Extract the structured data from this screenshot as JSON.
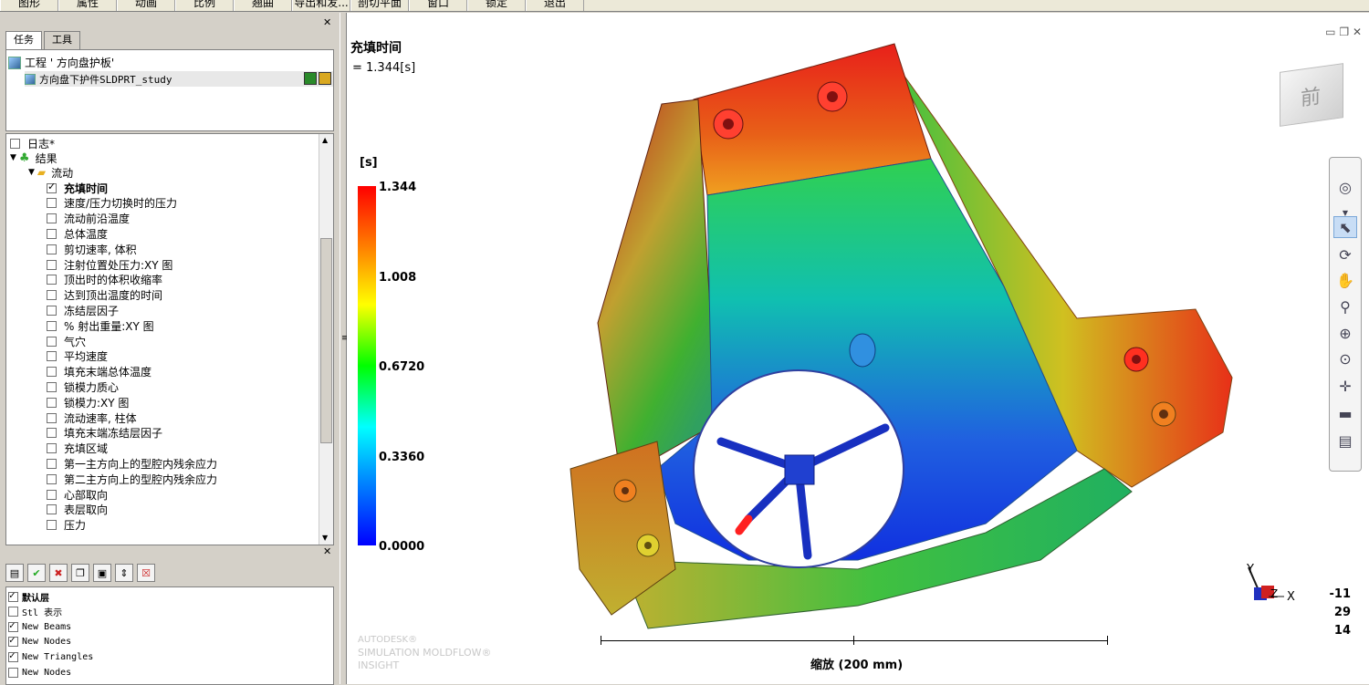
{
  "menubar": {
    "items": [
      "图形",
      "属性",
      "动画",
      "比例",
      "翘曲",
      "导出和发...",
      "剖切平面",
      "窗口",
      "锁定",
      "退出"
    ]
  },
  "left_panel": {
    "tabs": [
      "任务",
      "工具"
    ],
    "project": {
      "name": "工程 ' 方向盘护板'",
      "study": "方向盘下护件SLDPRT_study"
    },
    "tree": {
      "log": "日志*",
      "results": "结果",
      "flow": "流动",
      "items": [
        {
          "label": "充填时间",
          "checked": true
        },
        {
          "label": "速度/压力切换时的压力",
          "checked": false
        },
        {
          "label": "流动前沿温度",
          "checked": false
        },
        {
          "label": "总体温度",
          "checked": false
        },
        {
          "label": "剪切速率, 体积",
          "checked": false
        },
        {
          "label": "注射位置处压力:XY 图",
          "checked": false
        },
        {
          "label": "顶出时的体积收缩率",
          "checked": false
        },
        {
          "label": "达到顶出温度的时间",
          "checked": false
        },
        {
          "label": "冻结层因子",
          "checked": false
        },
        {
          "label": "% 射出重量:XY 图",
          "checked": false
        },
        {
          "label": "气穴",
          "checked": false
        },
        {
          "label": "平均速度",
          "checked": false
        },
        {
          "label": "填充末端总体温度",
          "checked": false
        },
        {
          "label": "锁模力质心",
          "checked": false
        },
        {
          "label": "锁模力:XY 图",
          "checked": false
        },
        {
          "label": "流动速率, 柱体",
          "checked": false
        },
        {
          "label": "填充末端冻结层因子",
          "checked": false
        },
        {
          "label": "充填区域",
          "checked": false
        },
        {
          "label": "第一主方向上的型腔内残余应力",
          "checked": false
        },
        {
          "label": "第二主方向上的型腔内残余应力",
          "checked": false
        },
        {
          "label": "心部取向",
          "checked": false
        },
        {
          "label": "表层取向",
          "checked": false
        },
        {
          "label": "压力",
          "checked": false
        }
      ]
    },
    "layers": [
      {
        "label": "默认层",
        "checked": true
      },
      {
        "label": "Stl 表示",
        "checked": false
      },
      {
        "label": "New Beams",
        "checked": true
      },
      {
        "label": "New Nodes",
        "checked": true
      },
      {
        "label": "New Triangles",
        "checked": true
      },
      {
        "label": "New Nodes",
        "checked": false
      }
    ]
  },
  "viewport": {
    "result_title": "充填时间",
    "result_value": "= 1.344[s]",
    "legend": {
      "unit": "[s]",
      "labels": [
        "1.344",
        "1.008",
        "0.6720",
        "0.3360",
        "0.0000"
      ]
    },
    "scale": "缩放 (200 mm)",
    "brand": [
      "AUTODESK®",
      "SIMULATION MOLDFLOW®",
      "INSIGHT"
    ],
    "axes": {
      "y": "Y",
      "z": "Z",
      "x": "X"
    },
    "rotation": [
      "-11",
      "29",
      "14"
    ],
    "view_cube_label": "前"
  }
}
